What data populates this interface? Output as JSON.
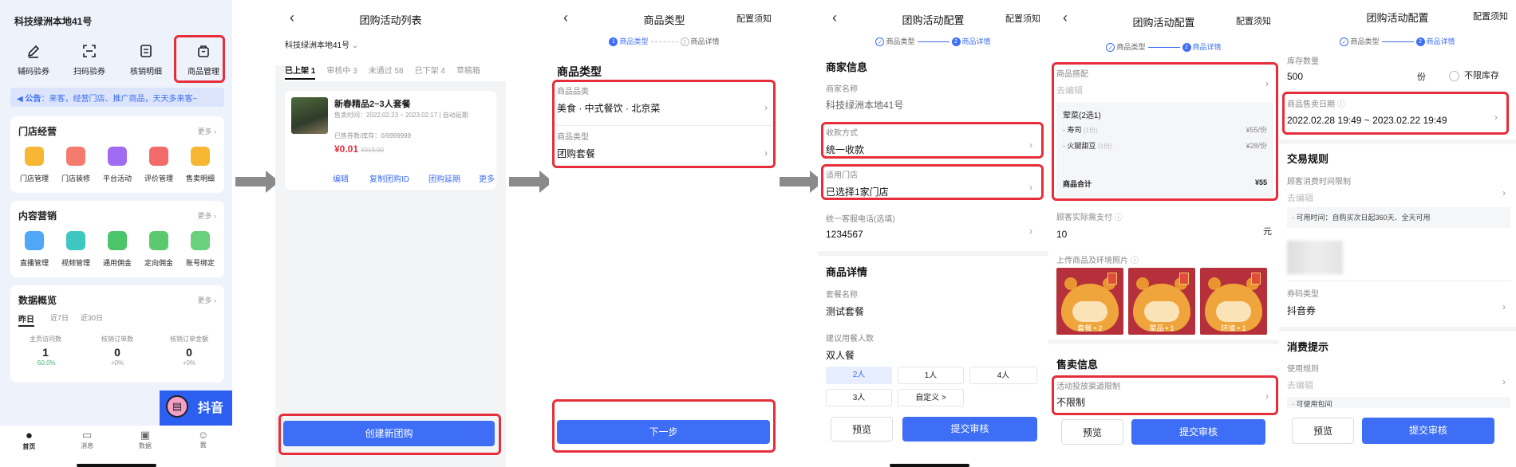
{
  "s1": {
    "shop": "科技绿洲本地41号",
    "actions": [
      "辅码验券",
      "扫码验券",
      "核销明细",
      "商品管理"
    ],
    "notice_label": "公告",
    "notice": "：来客，经营门店、推广商品，天天多来客~",
    "store_title": "门店经营",
    "more": "更多",
    "store_items": [
      "门店管理",
      "门店装修",
      "平台活动",
      "评价管理",
      "售卖明细"
    ],
    "content_title": "内容营销",
    "content_items": [
      "直播管理",
      "视频管理",
      "通用佣金",
      "定向佣金",
      "账号绑定"
    ],
    "data_title": "数据概览",
    "tabs": [
      "昨日",
      "近7日",
      "近30日"
    ],
    "stats": [
      {
        "label": "主页访问数",
        "value": "1",
        "change": "-50.0%"
      },
      {
        "label": "核销订单数",
        "value": "0",
        "change": "+0%"
      },
      {
        "label": "核销订单金额",
        "value": "0",
        "change": "+0%"
      }
    ],
    "banner": "抖音",
    "nav": [
      "首页",
      "消息",
      "数据",
      "我"
    ]
  },
  "s2": {
    "back": "<",
    "title": "团购活动列表",
    "shop": "科技绿洲本地41号",
    "tabs": [
      "已上架 1",
      "审核中 3",
      "未通过 58",
      "已下架 4",
      "草稿箱"
    ],
    "item": {
      "name": "新春精品2~3人套餐",
      "time": "售卖时间：2022.02.23 ~ 2023.02.17 | 自动延期",
      "stock": "已售券数/库存：0/9999999",
      "price": "¥0.01",
      "orig": "¥319.00",
      "actions": [
        "编辑",
        "复制团购ID",
        "团购延期",
        "更多"
      ]
    },
    "create": "创建新团购"
  },
  "s3": {
    "title": "商品类型",
    "note": "配置须知",
    "steps": [
      "商品类型",
      "商品详情"
    ],
    "section": "商品类型",
    "cat_label": "商品品类",
    "cat_value": "美食 · 中式餐饮 · 北京菜",
    "type_label": "商品类型",
    "type_value": "团购套餐",
    "next": "下一步"
  },
  "s4": {
    "title": "团购活动配置",
    "note": "配置须知",
    "steps": [
      "商品类型",
      "商品详情"
    ],
    "merchant_title": "商家信息",
    "name_label": "商家名称",
    "name_value": "科技绿洲本地41号",
    "pay_label": "收款方式",
    "pay_value": "统一收款",
    "store_label": "适用门店",
    "store_value": "已选择1家门店",
    "phone_label": "统一客服电话(选填)",
    "phone_value": "1234567",
    "detail_title": "商品详情",
    "pkg_label": "套餐名称",
    "pkg_value": "测试套餐",
    "ppl_label": "建议用餐人数",
    "ppl_value": "双人餐",
    "ppl_opts": [
      "2人",
      "1人",
      "4人",
      "3人",
      "自定义 >"
    ],
    "preview": "预览",
    "submit": "提交审核"
  },
  "s5": {
    "title": "团购活动配置",
    "note": "配置须知",
    "steps": [
      "商品类型",
      "商品详情"
    ],
    "combo_label": "商品搭配",
    "combo_hint": "去编辑",
    "group": "荤菜(2选1)",
    "dishes": [
      {
        "name": "· 寿司",
        "qty": "(1份)",
        "price": "¥55/份"
      },
      {
        "name": "· 火腿甜豆",
        "qty": "(1份)",
        "price": "¥28/份"
      }
    ],
    "total_label": "商品合计",
    "total": "¥55",
    "pay_label": "顾客实际需支付",
    "pay_value": "10",
    "unit": "元",
    "photo_label": "上传商品及环境照片",
    "photos": [
      "套餐 • 2",
      "菜品 • 1",
      "环境 • 1"
    ],
    "sale_title": "售卖信息",
    "channel_label": "活动投放渠道限制",
    "channel_value": "不限制",
    "preview": "预览",
    "submit": "提交审核"
  },
  "s6": {
    "title": "团购活动配置",
    "note": "配置须知",
    "steps": [
      "商品类型",
      "商品详情"
    ],
    "stock_label": "库存数量",
    "stock_value": "500",
    "stock_unit": "份",
    "unlimited": "不限库存",
    "date_label": "商品售卖日期",
    "date_value": "2022.02.28 19:49 ~ 2023.02.22 19:49",
    "trade_title": "交易规则",
    "time_label": "顾客消费时间限制",
    "time_hint": "去编辑",
    "avail": "· 可用时间：自购买次日起360天、全天可用",
    "coupon_label": "券码类型",
    "coupon_value": "抖音券",
    "tip_title": "消费提示",
    "rule_label": "使用规则",
    "rule_hint": "去编辑",
    "rule_peek": "· 可使用包间",
    "preview": "预览",
    "submit": "提交审核"
  },
  "colors": {
    "accent": "#3d6ef5",
    "highlight": "#e62e3a",
    "price": "#e62e3a"
  }
}
